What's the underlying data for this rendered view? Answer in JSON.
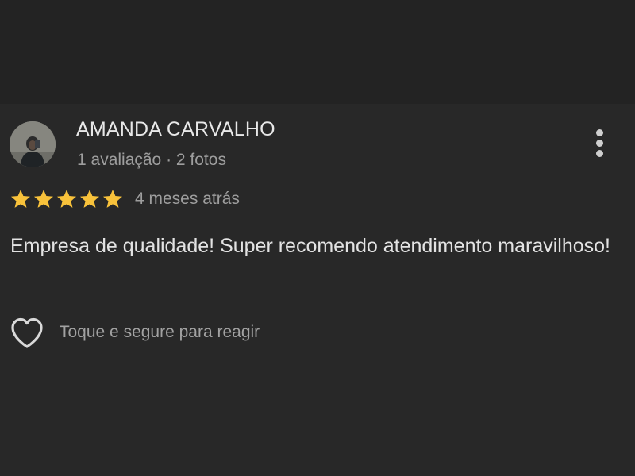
{
  "review": {
    "reviewer_name": "AMANDA CARVALHO",
    "reviewer_meta": "1 avaliação · 2 fotos",
    "rating": 5,
    "rating_max": 5,
    "time_ago": "4 meses atrás",
    "text": "Empresa de qualidade! Super recomendo atendimento maravilhoso!",
    "react_label": "Toque e segure para reagir"
  },
  "icons": {
    "avatar": "avatar",
    "star": "star-icon",
    "more": "more-vertical-icon",
    "heart": "heart-outline-icon"
  },
  "colors": {
    "background": "#262626",
    "star": "#f8c23b",
    "primary_text": "#e8e8e8",
    "secondary_text": "#9e9e9e"
  }
}
